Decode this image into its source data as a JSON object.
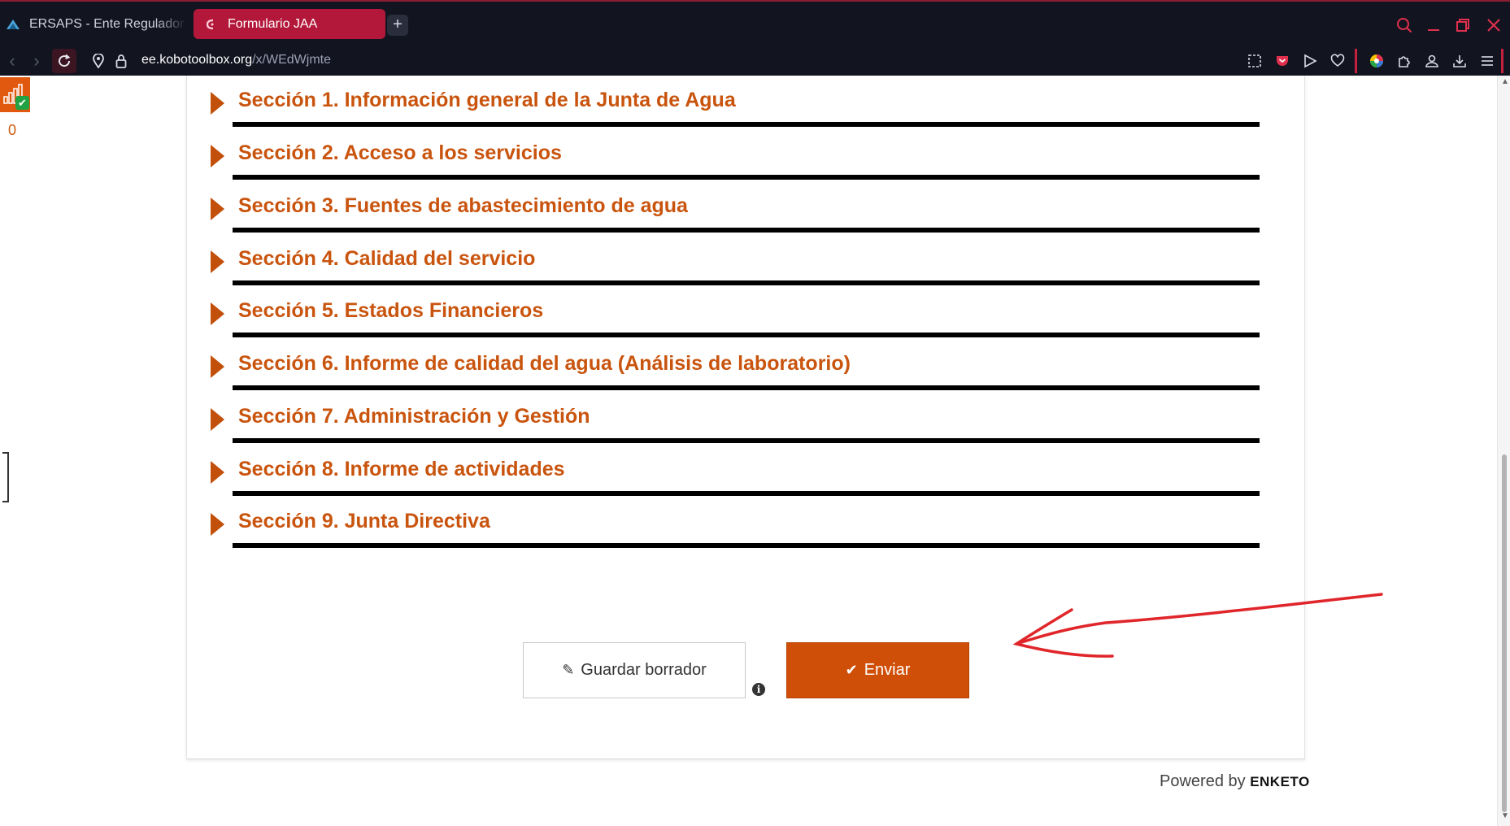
{
  "browser": {
    "tabs": [
      {
        "title": "ERSAPS - Ente Regulador",
        "active": false
      },
      {
        "title": "Formulario JAA",
        "active": true
      }
    ],
    "new_tab_symbol": "+",
    "url_host": "ee.kobotoolbox.org",
    "url_path": "/x/WEdWjmte",
    "accent_color": "#b3183a"
  },
  "sidebar": {
    "queue_count": "0",
    "status_icon": "signal-check-icon"
  },
  "form": {
    "sections": [
      {
        "label": "Sección 1. Información general de la Junta de Agua"
      },
      {
        "label": "Sección 2. Acceso a los servicios"
      },
      {
        "label": "Sección 3. Fuentes de abastecimiento de agua"
      },
      {
        "label": "Sección 4. Calidad del servicio"
      },
      {
        "label": "Sección 5. Estados Financieros"
      },
      {
        "label": "Sección 6. Informe de calidad del agua (Análisis de laboratorio)"
      },
      {
        "label": "Sección 7. Administración y Gestión"
      },
      {
        "label": "Sección 8. Informe de actividades"
      },
      {
        "label": "Sección 9. Junta Directiva"
      }
    ],
    "section_color": "#c9540e",
    "buttons": {
      "save_draft": "Guardar borrador",
      "submit": "Enviar",
      "submit_color": "#d04f08"
    }
  },
  "footer": {
    "powered_by": "Powered by",
    "brand": "ENKETO"
  }
}
